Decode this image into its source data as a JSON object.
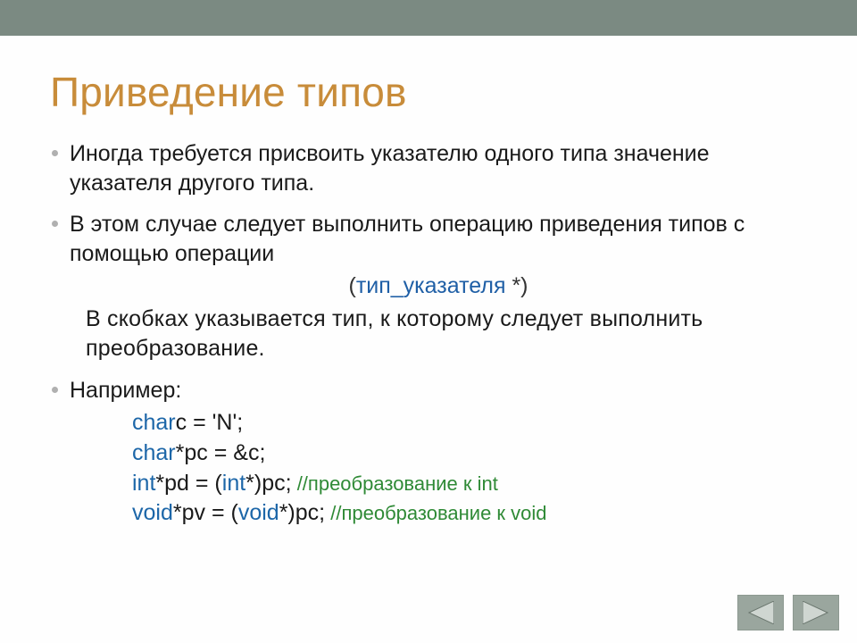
{
  "title": "Приведение типов",
  "bullets": {
    "b1": "Иногда требуется присвоить указателю одного типа значение указателя другого типа.",
    "b2": "В этом случае следует выполнить операцию приведения типов с помощью операции",
    "b3": "Например:"
  },
  "syntax": {
    "open": "(",
    "type_text": "тип_указателя ",
    "close": "*)"
  },
  "explain": "В скобках указывается тип, к которому следует выполнить преобразование.",
  "code": {
    "l1_kw": "char",
    "l1_rest": "c = 'N';",
    "l2_kw": "char",
    "l2_rest": "*pc = &c;",
    "l3_kw": "int",
    "l3_mid": "*pd = (",
    "l3_kw2": "int",
    "l3_after": "*)pc;",
    "l3_cmt": " //преобразование к int",
    "l4_kw": "void",
    "l4_mid": "*pv = (",
    "l4_kw2": "void",
    "l4_after": "*)pc;",
    "l4_cmt": " //преобразование к void"
  },
  "nav": {
    "prev": "prev",
    "next": "next"
  }
}
